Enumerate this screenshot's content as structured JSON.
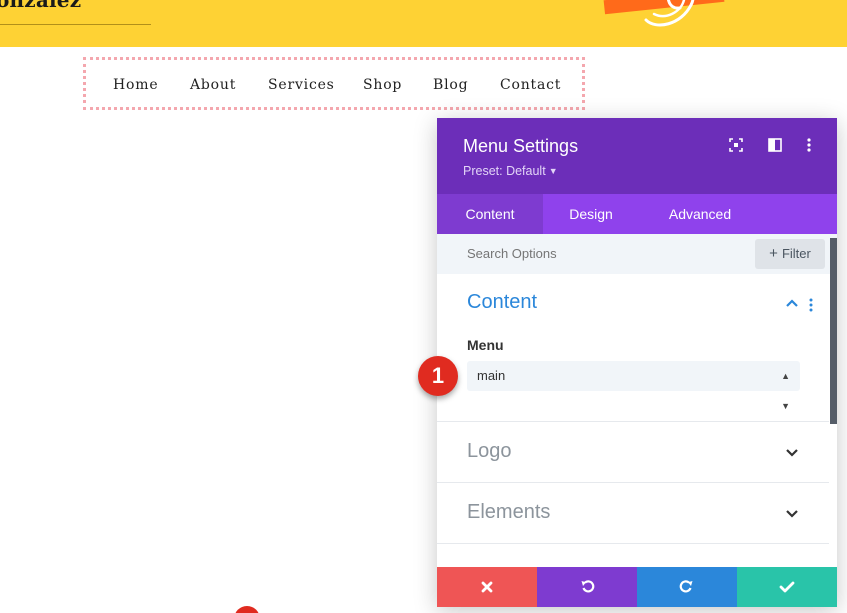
{
  "site": {
    "title": "onzalez",
    "menu": [
      "Home",
      "About",
      "Services",
      "Shop",
      "Blog",
      "Contact"
    ]
  },
  "modal": {
    "title": "Menu Settings",
    "preset": "Preset: Default",
    "tabs": [
      {
        "label": "Content",
        "active": true
      },
      {
        "label": "Design",
        "active": false
      },
      {
        "label": "Advanced",
        "active": false
      }
    ],
    "search": {
      "placeholder": "Search Options"
    },
    "filter_label": "Filter",
    "content_section": {
      "title": "Content",
      "field_label": "Menu",
      "selected_value": "main"
    },
    "collapsed_sections": [
      "Logo",
      "Elements"
    ]
  },
  "annotation": {
    "step": "1"
  },
  "icons": {
    "header": [
      "fullscreen-icon",
      "split-view-icon",
      "more-options-icon"
    ],
    "footer": [
      "cancel-icon",
      "undo-icon",
      "redo-icon",
      "save-check-icon"
    ]
  },
  "colors": {
    "header_yellow": "#fed234",
    "modal_header": "#6c2eb9",
    "tab_bar": "#8f42ec",
    "accent_blue": "#2b87da",
    "cancel": "#ef5555",
    "undo": "#7e3bd0",
    "redo": "#2b87da",
    "save": "#29c4a9",
    "badge": "#e02b20"
  }
}
